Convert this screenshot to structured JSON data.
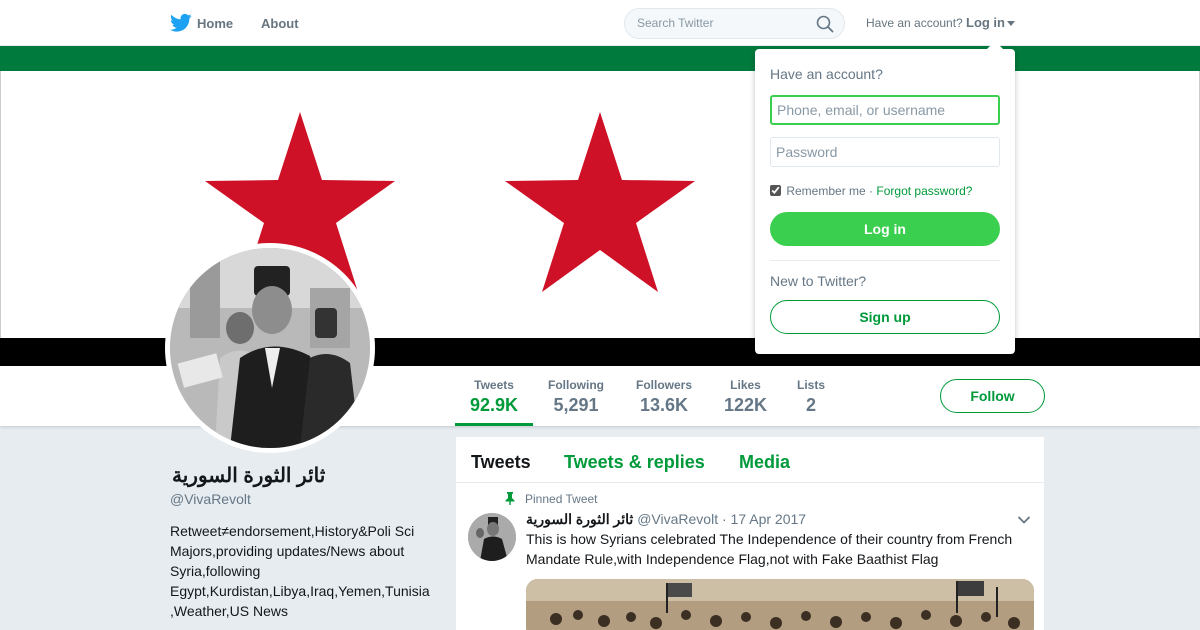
{
  "colors": {
    "accent": "#3bcf4f",
    "accent_dark": "#009a3a",
    "flag_green": "#007a3d",
    "flag_red": "#ce1126",
    "flag_black": "#000000",
    "muted_text": "#657786",
    "page_bg": "#e6ecf0"
  },
  "nav": {
    "logo_icon": "twitter-bird-icon",
    "home_label": "Home",
    "about_label": "About",
    "search_placeholder": "Search Twitter",
    "search_icon": "search-icon",
    "have_account": "Have an account?",
    "login_label": "Log in"
  },
  "banner": {
    "description_icon": "flag-banner",
    "stars": 2
  },
  "stats": [
    {
      "label": "Tweets",
      "value": "92.9K"
    },
    {
      "label": "Following",
      "value": "5,291"
    },
    {
      "label": "Followers",
      "value": "13.6K"
    },
    {
      "label": "Likes",
      "value": "122K"
    },
    {
      "label": "Lists",
      "value": "2"
    }
  ],
  "follow_label": "Follow",
  "profile": {
    "name": "ثائر الثورة السورية",
    "handle": "@VivaRevolt",
    "bio": "Retweet≠endorsement,History&Poli Sci Majors,providing updates/News about Syria,following Egypt,Kurdistan,Libya,Iraq,Yemen,Tunisia ,Weather,US News"
  },
  "timeline": {
    "tabs": [
      "Tweets",
      "Tweets & replies",
      "Media"
    ],
    "pinned_label": "Pinned Tweet",
    "tweet": {
      "name": "ثائر الثورة السورية",
      "handle": "@VivaRevolt",
      "separator": "·",
      "date": "17 Apr 2017",
      "text": "This is how Syrians celebrated The Independence of their country from French Mandate Rule,with Independence Flag,not with Fake Baathist Flag"
    }
  },
  "login_dropdown": {
    "title": "Have an account?",
    "username_placeholder": "Phone, email, or username",
    "password_placeholder": "Password",
    "remember_label": "Remember me",
    "separator": "·",
    "forgot_label": "Forgot password?",
    "login_button": "Log in",
    "new_label": "New to Twitter?",
    "signup_button": "Sign up"
  }
}
